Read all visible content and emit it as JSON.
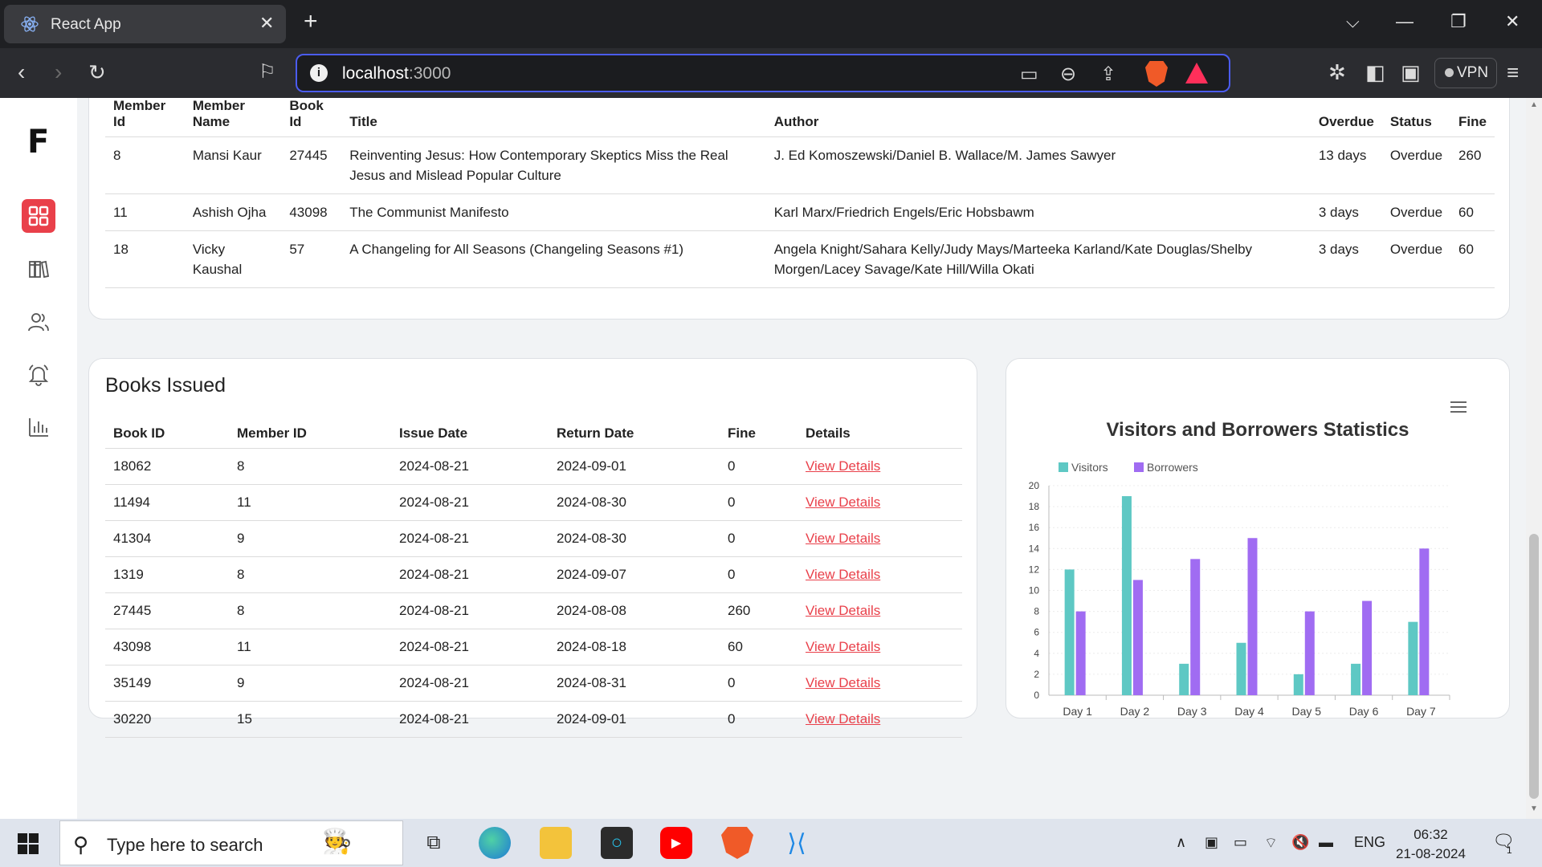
{
  "browser": {
    "tab_title": "React App",
    "url_host": "localhost",
    "url_port": ":3000",
    "vpn_label": "VPN"
  },
  "app": {
    "logo": "F",
    "sidebar_items": [
      {
        "name": "dashboard",
        "icon": "grid-icon",
        "active": true
      },
      {
        "name": "books",
        "icon": "books-icon",
        "active": false
      },
      {
        "name": "members",
        "icon": "users-icon",
        "active": false
      },
      {
        "name": "notifications",
        "icon": "bell-icon",
        "active": false
      },
      {
        "name": "reports",
        "icon": "bar-chart-icon",
        "active": false
      }
    ]
  },
  "overdue": {
    "headers": {
      "member_id": "Member Id",
      "member_name": "Member Name",
      "book_id": "Book Id",
      "title": "Title",
      "author": "Author",
      "overdue": "Overdue",
      "status": "Status",
      "fine": "Fine"
    },
    "rows": [
      {
        "member_id": "8",
        "member_name": "Mansi Kaur",
        "book_id": "27445",
        "title": "Reinventing Jesus: How Contemporary Skeptics Miss the Real Jesus and Mislead Popular Culture",
        "author": "J. Ed Komoszewski/Daniel B. Wallace/M. James Sawyer",
        "overdue": "13 days",
        "status": "Overdue",
        "fine": "260"
      },
      {
        "member_id": "11",
        "member_name": "Ashish Ojha",
        "book_id": "43098",
        "title": "The Communist Manifesto",
        "author": "Karl Marx/Friedrich Engels/Eric Hobsbawm",
        "overdue": "3 days",
        "status": "Overdue",
        "fine": "60"
      },
      {
        "member_id": "18",
        "member_name": "Vicky Kaushal",
        "book_id": "57",
        "title": "A Changeling for All Seasons (Changeling Seasons #1)",
        "author": "Angela Knight/Sahara Kelly/Judy Mays/Marteeka Karland/Kate Douglas/Shelby Morgen/Lacey Savage/Kate Hill/Willa Okati",
        "overdue": "3 days",
        "status": "Overdue",
        "fine": "60"
      }
    ]
  },
  "issued": {
    "title": "Books Issued",
    "headers": {
      "book_id": "Book ID",
      "member_id": "Member ID",
      "issue_date": "Issue Date",
      "return_date": "Return Date",
      "fine": "Fine",
      "details": "Details"
    },
    "rows": [
      {
        "book_id": "18062",
        "member_id": "8",
        "issue_date": "2024-08-21",
        "return_date": "2024-09-01",
        "fine": "0",
        "details": "View Details"
      },
      {
        "book_id": "11494",
        "member_id": "11",
        "issue_date": "2024-08-21",
        "return_date": "2024-08-30",
        "fine": "0",
        "details": "View Details"
      },
      {
        "book_id": "41304",
        "member_id": "9",
        "issue_date": "2024-08-21",
        "return_date": "2024-08-30",
        "fine": "0",
        "details": "View Details"
      },
      {
        "book_id": "1319",
        "member_id": "8",
        "issue_date": "2024-08-21",
        "return_date": "2024-09-07",
        "fine": "0",
        "details": "View Details"
      },
      {
        "book_id": "27445",
        "member_id": "8",
        "issue_date": "2024-08-21",
        "return_date": "2024-08-08",
        "fine": "260",
        "details": "View Details"
      },
      {
        "book_id": "43098",
        "member_id": "11",
        "issue_date": "2024-08-21",
        "return_date": "2024-08-18",
        "fine": "60",
        "details": "View Details"
      },
      {
        "book_id": "35149",
        "member_id": "9",
        "issue_date": "2024-08-21",
        "return_date": "2024-08-31",
        "fine": "0",
        "details": "View Details"
      },
      {
        "book_id": "30220",
        "member_id": "15",
        "issue_date": "2024-08-21",
        "return_date": "2024-09-01",
        "fine": "0",
        "details": "View Details"
      }
    ]
  },
  "chart_data": {
    "type": "bar",
    "title": "Visitors and Borrowers Statistics",
    "categories": [
      "Day 1",
      "Day 2",
      "Day 3",
      "Day 4",
      "Day 5",
      "Day 6",
      "Day 7"
    ],
    "series": [
      {
        "name": "Visitors",
        "color": "#5ec8c4",
        "values": [
          12,
          19,
          3,
          5,
          2,
          3,
          7
        ]
      },
      {
        "name": "Borrowers",
        "color": "#a06cf2",
        "values": [
          8,
          11,
          13,
          15,
          8,
          9,
          14
        ]
      }
    ],
    "ylim": [
      0,
      20
    ],
    "yticks": [
      0,
      2,
      4,
      6,
      8,
      10,
      12,
      14,
      16,
      18,
      20
    ],
    "legend": "top-left",
    "grid": true
  },
  "taskbar": {
    "search_placeholder": "Type here to search",
    "language": "ENG",
    "time": "06:32",
    "date": "21-08-2024",
    "notification_count": "1",
    "apps": [
      "task-view-icon",
      "edge-icon",
      "file-explorer-icon",
      "cortana-icon",
      "youtube-icon",
      "brave-icon",
      "vscode-icon"
    ]
  }
}
